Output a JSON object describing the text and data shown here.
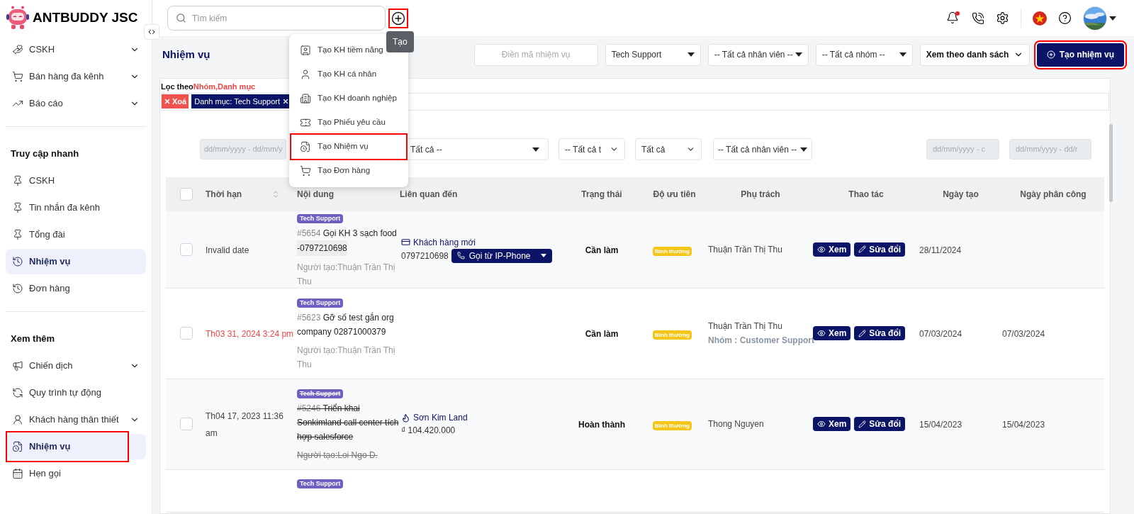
{
  "brand": {
    "name": "ANTBUDDY JSC"
  },
  "search": {
    "placeholder": "Tìm kiếm"
  },
  "create_button": {
    "highlighted": true
  },
  "tooltip": {
    "text": "Tạo"
  },
  "create_menu": [
    {
      "label": "Tạo KH tiềm năng",
      "highlighted": false
    },
    {
      "label": "Tạo KH cá nhân",
      "highlighted": false
    },
    {
      "label": "Tạo KH doanh nghiệp",
      "highlighted": false
    },
    {
      "label": "Tạo Phiếu yêu cầu",
      "highlighted": false
    },
    {
      "label": "Tạo Nhiệm vụ",
      "highlighted": true
    },
    {
      "label": "Tạo Đơn hàng",
      "highlighted": false
    }
  ],
  "topbar": {
    "notification_dot": true
  },
  "sidebar": {
    "sections": [
      {
        "items": [
          {
            "label": "CSKH",
            "expandable": true,
            "selected": false,
            "highlighted": false
          },
          {
            "label": "Bán hàng đa kênh",
            "expandable": true,
            "selected": false,
            "highlighted": false
          },
          {
            "label": "Báo cáo",
            "expandable": true,
            "selected": false,
            "highlighted": false
          }
        ]
      },
      {
        "title": "Truy cập nhanh",
        "items": [
          {
            "label": "CSKH",
            "expandable": false,
            "selected": false,
            "highlighted": false
          },
          {
            "label": "Tin nhắn đa kênh",
            "expandable": false,
            "selected": false,
            "highlighted": false
          },
          {
            "label": "Tổng đài",
            "expandable": false,
            "selected": false,
            "highlighted": false
          },
          {
            "label": "Nhiệm vụ",
            "expandable": false,
            "selected": true,
            "highlighted": false
          },
          {
            "label": "Đơn hàng",
            "expandable": false,
            "selected": false,
            "highlighted": false
          }
        ]
      },
      {
        "title": "Xem thêm",
        "items": [
          {
            "label": "Chiến dịch",
            "expandable": true,
            "selected": false,
            "highlighted": false
          },
          {
            "label": "Quy trình tự động",
            "expandable": false,
            "selected": false,
            "highlighted": false
          },
          {
            "label": "Khách hàng thân thiết",
            "expandable": true,
            "selected": false,
            "highlighted": false
          },
          {
            "label": "Nhiệm vụ",
            "expandable": false,
            "selected": true,
            "highlighted": true
          },
          {
            "label": "Hẹn gọi",
            "expandable": false,
            "selected": false,
            "highlighted": false
          }
        ]
      }
    ]
  },
  "page_title": "Nhiệm vụ",
  "toolbar": {
    "code_placeholder": "Điền mã nhiệm vụ",
    "selects": [
      "Tech Support",
      "-- Tất cả nhân viên --",
      "-- Tất cả nhóm --"
    ],
    "view_select": "Xem theo danh sách",
    "new_task_button": {
      "label": "Tạo nhiệm vụ",
      "highlighted": true
    }
  },
  "filter": {
    "label": "Lọc theo",
    "fields": "Nhóm,Danh mục",
    "clear_button": "Xoá",
    "chips": [
      "Danh mục: Tech Support"
    ]
  },
  "table_filters": {
    "date_from": "dd/mm/yyyy - dd/mm/y",
    "selects": [
      "Tất cả --",
      "-- Tất cả t",
      "Tất cả",
      "-- Tất cả nhân viên --"
    ],
    "created_range": "dd/mm/yyyy - c",
    "assigned_range": "dd/mm/yyyy - dd/r"
  },
  "table": {
    "all_checked": false,
    "columns": [
      "Thời hạn",
      "Nội dung",
      "Liên quan đến",
      "Trạng thái",
      "Độ ưu tiên",
      "Phụ trách",
      "Thao tác",
      "Ngày tạo",
      "Ngày phân công"
    ],
    "rows": [
      {
        "checked": false,
        "deadline": "Invalid date",
        "overdue": false,
        "tag": "Tech Support",
        "id": "#5654",
        "title": "Gọi KH 3 sạch food",
        "phone": "-0797210698",
        "creator": "Người tạo:Thuận Trần Thị Thu",
        "done": false,
        "related": {
          "kind": "customer",
          "name": "Khách hàng mới",
          "detail": "0797210698",
          "call_button": "Gọi từ IP-Phone"
        },
        "status": "Cần làm",
        "priority": "Bình thường",
        "assignee": "Thuận Trần Thị Thu",
        "view_label": "Xem",
        "edit_label": "Sửa đổi",
        "created": "28/11/2024"
      },
      {
        "checked": false,
        "deadline": "Th03 31, 2024 3:24 pm",
        "overdue": true,
        "tag": "Tech Support",
        "id": "#5623",
        "title": "Gỡ số test gắn org company 02871000379",
        "creator": "Người tạo:Thuận Trần Thị Thu",
        "done": false,
        "status": "Cần làm",
        "priority": "Bình thường",
        "assignee": "Thuận Trần Thị Thu",
        "group": "Nhóm : Customer Support",
        "view_label": "Xem",
        "edit_label": "Sửa đổi",
        "created": "07/03/2024",
        "assigned": "07/03/2024"
      },
      {
        "checked": false,
        "deadline": "Th04 17, 2023 11:36 am",
        "overdue": false,
        "tag": "Tech Support",
        "id": "#5246",
        "title": "Triển khai Sonkimland call center tích hợp salesforce",
        "creator": "Người tạo:Loi Ngo D.",
        "done": true,
        "related": {
          "kind": "deal",
          "name": "Sơn Kim Land",
          "detail": "₫ 104.420.000"
        },
        "status": "Hoàn thành",
        "priority": "Bình thường",
        "assignee": "Thong Nguyen",
        "view_label": "Xem",
        "edit_label": "Sửa đổi",
        "created": "15/04/2023",
        "assigned": "15/04/2023"
      },
      {
        "partial": true,
        "tag": "Tech Support"
      }
    ]
  }
}
